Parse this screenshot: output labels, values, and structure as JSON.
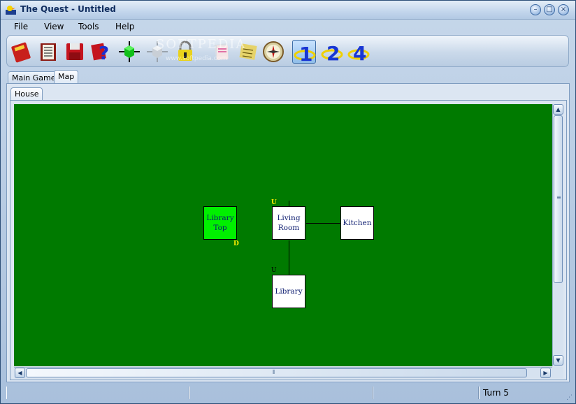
{
  "window": {
    "title": "The Quest - Untitled",
    "controls": [
      "minimize",
      "maximize",
      "close"
    ]
  },
  "menu": {
    "items": [
      "File",
      "View",
      "Tools",
      "Help"
    ]
  },
  "toolbar": {
    "buttons": [
      {
        "icon": "book-red-icon"
      },
      {
        "icon": "open-book-icon"
      },
      {
        "icon": "floppy-save-icon"
      },
      {
        "icon": "help-question-icon"
      },
      {
        "icon": "green-cube-icon"
      },
      {
        "icon": "grey-cube-icon"
      },
      {
        "icon": "padlock-icon"
      },
      {
        "icon": "papers-icon"
      },
      {
        "icon": "notepad-icon"
      },
      {
        "icon": "compass-icon"
      },
      {
        "icon": "one-direction-icon",
        "label": "1"
      },
      {
        "icon": "two-direction-icon",
        "label": "2"
      },
      {
        "icon": "four-direction-icon",
        "label": "4"
      }
    ],
    "watermark": "SOFTPEDIA",
    "watermark_sub": "www.softpedia.com"
  },
  "tabs": {
    "main": [
      "Main Game",
      "Map"
    ],
    "active_main": "Map",
    "sub": [
      "House"
    ]
  },
  "map": {
    "background_color": "#007a00",
    "rooms": [
      {
        "name_line1": "Library",
        "name_line2": "Top",
        "current": true
      },
      {
        "name_line1": "Living",
        "name_line2": "Room",
        "current": false
      },
      {
        "name_line1": "Kitchen",
        "name_line2": "",
        "current": false
      },
      {
        "name_line1": "Library",
        "name_line2": "",
        "current": false
      }
    ],
    "exit_marks": [
      "U",
      "D",
      "U"
    ]
  },
  "status": {
    "pane1": "",
    "pane2": "",
    "pane3": "",
    "turn": "Turn 5"
  },
  "colors": {
    "current_room": "#00f000",
    "exit_mark": "#ffef00",
    "room_text": "#0b1b6f"
  }
}
